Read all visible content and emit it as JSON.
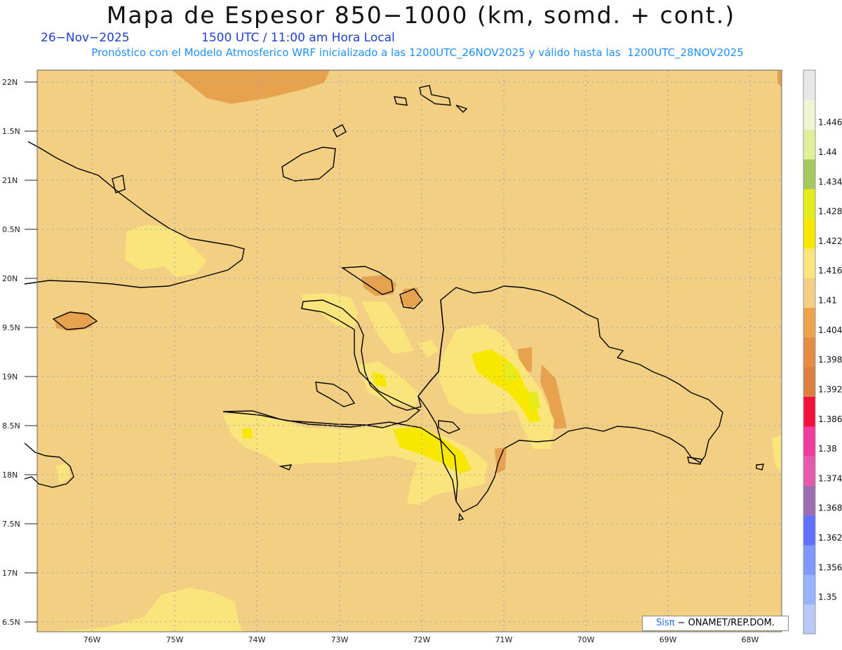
{
  "header": {
    "title": "Mapa de Espesor 850−1000 (km, somd. + cont.)",
    "date": "26−Nov−2025",
    "time": "1500 UTC / 11:00 am Hora Local",
    "subtitle": "Pronóstico con el Modelo Atmosferico WRF inicializado a las 1200UTC_26NOV2025 y válido hasta las  1200UTC_28NOV2025"
  },
  "map": {
    "lat_labels": [
      "22N",
      "1.5N",
      "21N",
      "0.5N",
      "20N",
      "9.5N",
      "19N",
      "8.5N",
      "18N",
      "7.5N",
      "17N",
      "6.5N"
    ],
    "lon_labels": [
      "76W",
      "75W",
      "74W",
      "73W",
      "72W",
      "71W",
      "70W",
      "69W",
      "68W"
    ],
    "background_color": "#f2cf82"
  },
  "colorbar": {
    "levels": [
      "1.35",
      "1.356",
      "1.362",
      "1.368",
      "1.374",
      "1.38",
      "1.386",
      "1.392",
      "1.398",
      "1.404",
      "1.41",
      "1.416",
      "1.422",
      "1.428",
      "1.434",
      "1.44",
      "1.446"
    ],
    "colors": [
      "#b8c8f8",
      "#98b4ff",
      "#8098ff",
      "#6070ff",
      "#9a6eb0",
      "#e65aac",
      "#f03c9c",
      "#f0103c",
      "#dc8040",
      "#e48c44",
      "#eca44c",
      "#f2cf82",
      "#fae47c",
      "#f8e800",
      "#e4ec1c",
      "#a8c85c",
      "#e0f098",
      "#eef6d4",
      "#e8e8e8"
    ]
  },
  "credit": {
    "sis": "Sisπ",
    "org": "− ONAMET/REP.DOM."
  }
}
